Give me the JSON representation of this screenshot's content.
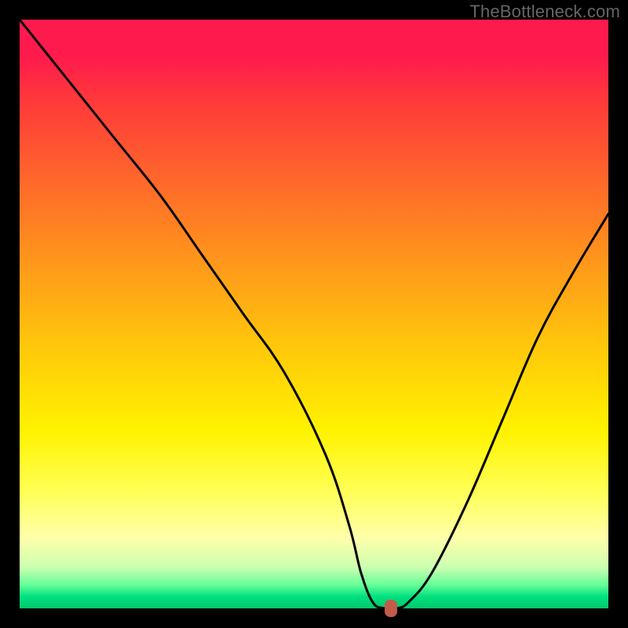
{
  "watermark": "TheBottleneck.com",
  "chart_data": {
    "type": "line",
    "title": "",
    "xlabel": "",
    "ylabel": "",
    "xlim": [
      0,
      100
    ],
    "ylim": [
      0,
      100
    ],
    "grid": false,
    "legend": false,
    "series": [
      {
        "name": "bottleneck-curve",
        "x": [
          0,
          8,
          16,
          24,
          31,
          38,
          45,
          52,
          56,
          58,
          60,
          62,
          64,
          66,
          70,
          76,
          82,
          88,
          94,
          100
        ],
        "y": [
          100,
          90,
          80,
          70,
          60,
          50,
          40,
          26,
          14,
          6,
          1,
          0,
          0,
          1,
          6,
          18,
          32,
          46,
          57,
          67
        ]
      }
    ],
    "marker": {
      "x": 63,
      "y": 0,
      "name": "optimal-point"
    },
    "background": {
      "type": "vertical-gradient",
      "stops": [
        {
          "pos": 0.0,
          "color": "#ff1a4d"
        },
        {
          "pos": 0.28,
          "color": "#ff6a2a"
        },
        {
          "pos": 0.56,
          "color": "#ffc90a"
        },
        {
          "pos": 0.8,
          "color": "#ffff55"
        },
        {
          "pos": 0.96,
          "color": "#66ff99"
        },
        {
          "pos": 1.0,
          "color": "#00c86a"
        }
      ]
    }
  }
}
